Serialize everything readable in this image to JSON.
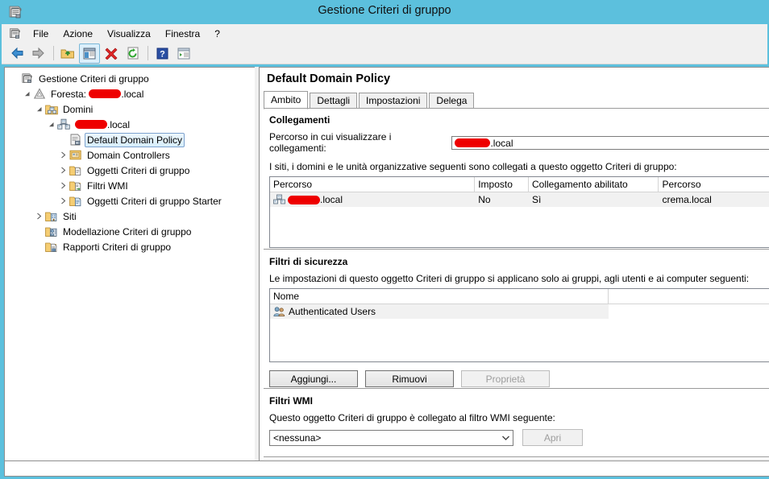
{
  "window": {
    "title": "Gestione Criteri di gruppo",
    "icon": "gpmc-icon"
  },
  "menubar": {
    "items": [
      {
        "label": "File",
        "name": "menu-file"
      },
      {
        "label": "Azione",
        "name": "menu-azione"
      },
      {
        "label": "Visualizza",
        "name": "menu-visualizza"
      },
      {
        "label": "Finestra",
        "name": "menu-finestra"
      },
      {
        "label": "?",
        "name": "menu-help"
      }
    ]
  },
  "toolbar": {
    "buttons": [
      {
        "name": "back-button",
        "icon": "back-arrow-icon"
      },
      {
        "name": "forward-button",
        "icon": "forward-arrow-icon"
      },
      {
        "name": "up-one-level-button",
        "icon": "folder-up-icon"
      },
      {
        "name": "show-hide-tree-button",
        "icon": "console-tree-icon",
        "selected": true
      },
      {
        "name": "delete-button",
        "icon": "delete-x-icon"
      },
      {
        "name": "refresh-button",
        "icon": "refresh-icon"
      },
      {
        "name": "help-button",
        "icon": "help-question-icon"
      },
      {
        "name": "properties-button",
        "icon": "properties-icon"
      }
    ]
  },
  "tree": {
    "nodes": [
      {
        "label": "Gestione Criteri di gruppo",
        "indent": 0,
        "expander": "none",
        "icon": "gpmc-icon",
        "name": "tree-item-gpmc"
      },
      {
        "label": "Foresta: ",
        "suffix": ".local",
        "redacted": true,
        "indent": 1,
        "expander": "expanded",
        "icon": "forest-icon",
        "name": "tree-item-foresta"
      },
      {
        "label": "Domini",
        "indent": 2,
        "expander": "expanded",
        "icon": "domains-icon",
        "name": "tree-item-domini"
      },
      {
        "label": "",
        "suffix": ".local",
        "redacted": true,
        "indent": 3,
        "expander": "expanded",
        "icon": "domain-icon",
        "name": "tree-item-domain"
      },
      {
        "label": "Default Domain Policy",
        "indent": 4,
        "expander": "none",
        "icon": "gpo-icon",
        "selected": true,
        "name": "tree-item-default-domain-policy"
      },
      {
        "label": "Domain Controllers",
        "indent": 4,
        "expander": "collapsed",
        "icon": "ou-icon",
        "name": "tree-item-domain-controllers"
      },
      {
        "label": "Oggetti Criteri di gruppo",
        "indent": 4,
        "expander": "collapsed",
        "icon": "gpo-folder-icon",
        "name": "tree-item-oggetti-criteri"
      },
      {
        "label": "Filtri WMI",
        "indent": 4,
        "expander": "collapsed",
        "icon": "wmi-folder-icon",
        "name": "tree-item-filtri-wmi"
      },
      {
        "label": "Oggetti Criteri di gruppo Starter",
        "indent": 4,
        "expander": "collapsed",
        "icon": "starter-gpo-icon",
        "name": "tree-item-starter-gpo"
      },
      {
        "label": "Siti",
        "indent": 2,
        "expander": "collapsed",
        "icon": "sites-icon",
        "name": "tree-item-siti"
      },
      {
        "label": "Modellazione Criteri di gruppo",
        "indent": 2,
        "expander": "none",
        "icon": "modeling-icon",
        "name": "tree-item-modellazione"
      },
      {
        "label": "Rapporti Criteri di gruppo",
        "indent": 2,
        "expander": "none",
        "icon": "results-icon",
        "name": "tree-item-rapporti"
      }
    ]
  },
  "detail": {
    "title": "Default Domain Policy",
    "tabs": [
      {
        "label": "Ambito",
        "active": true,
        "name": "tab-ambito"
      },
      {
        "label": "Dettagli",
        "active": false,
        "name": "tab-dettagli"
      },
      {
        "label": "Impostazioni",
        "active": false,
        "name": "tab-impostazioni"
      },
      {
        "label": "Delega",
        "active": false,
        "name": "tab-delega"
      }
    ],
    "links": {
      "heading": "Collegamenti",
      "location_label": "Percorso in cui visualizzare i collegamenti:",
      "location_value": ".local",
      "location_redacted": true,
      "description": "I siti, i domini e le unità organizzative seguenti sono collegati a questo oggetto Criteri di gruppo:",
      "columns": [
        "Percorso",
        "Imposto",
        "Collegamento abilitato",
        "Percorso"
      ],
      "rows": [
        {
          "percorso": ".local",
          "percorso_redacted": true,
          "imposto": "No",
          "abilitato": "Sì",
          "percorso2": "crema.local"
        }
      ]
    },
    "security": {
      "heading": "Filtri di sicurezza",
      "description": "Le impostazioni di questo oggetto Criteri di gruppo si applicano solo ai gruppi, agli utenti e ai computer seguenti:",
      "columns": [
        "Nome"
      ],
      "rows": [
        {
          "nome": "Authenticated Users",
          "icon": "users-group-icon"
        }
      ],
      "buttons": [
        {
          "label": "Aggiungi...",
          "disabled": false,
          "name": "add-button"
        },
        {
          "label": "Rimuovi",
          "disabled": false,
          "name": "remove-button"
        },
        {
          "label": "Proprietà",
          "disabled": true,
          "name": "properties-button"
        }
      ]
    },
    "wmi": {
      "heading": "Filtri WMI",
      "description": "Questo oggetto Criteri di gruppo è collegato al filtro WMI seguente:",
      "selected_filter": "<nessuna>",
      "open_button": {
        "label": "Apri",
        "disabled": true
      }
    }
  },
  "statusbar": {
    "text": ""
  },
  "colors": {
    "titlebar": "#5cc0dd",
    "redaction": "#ee0000",
    "selection_border": "#7da2ce",
    "panel_bg": "#ffffff",
    "chrome_bg": "#f0f0f0"
  }
}
